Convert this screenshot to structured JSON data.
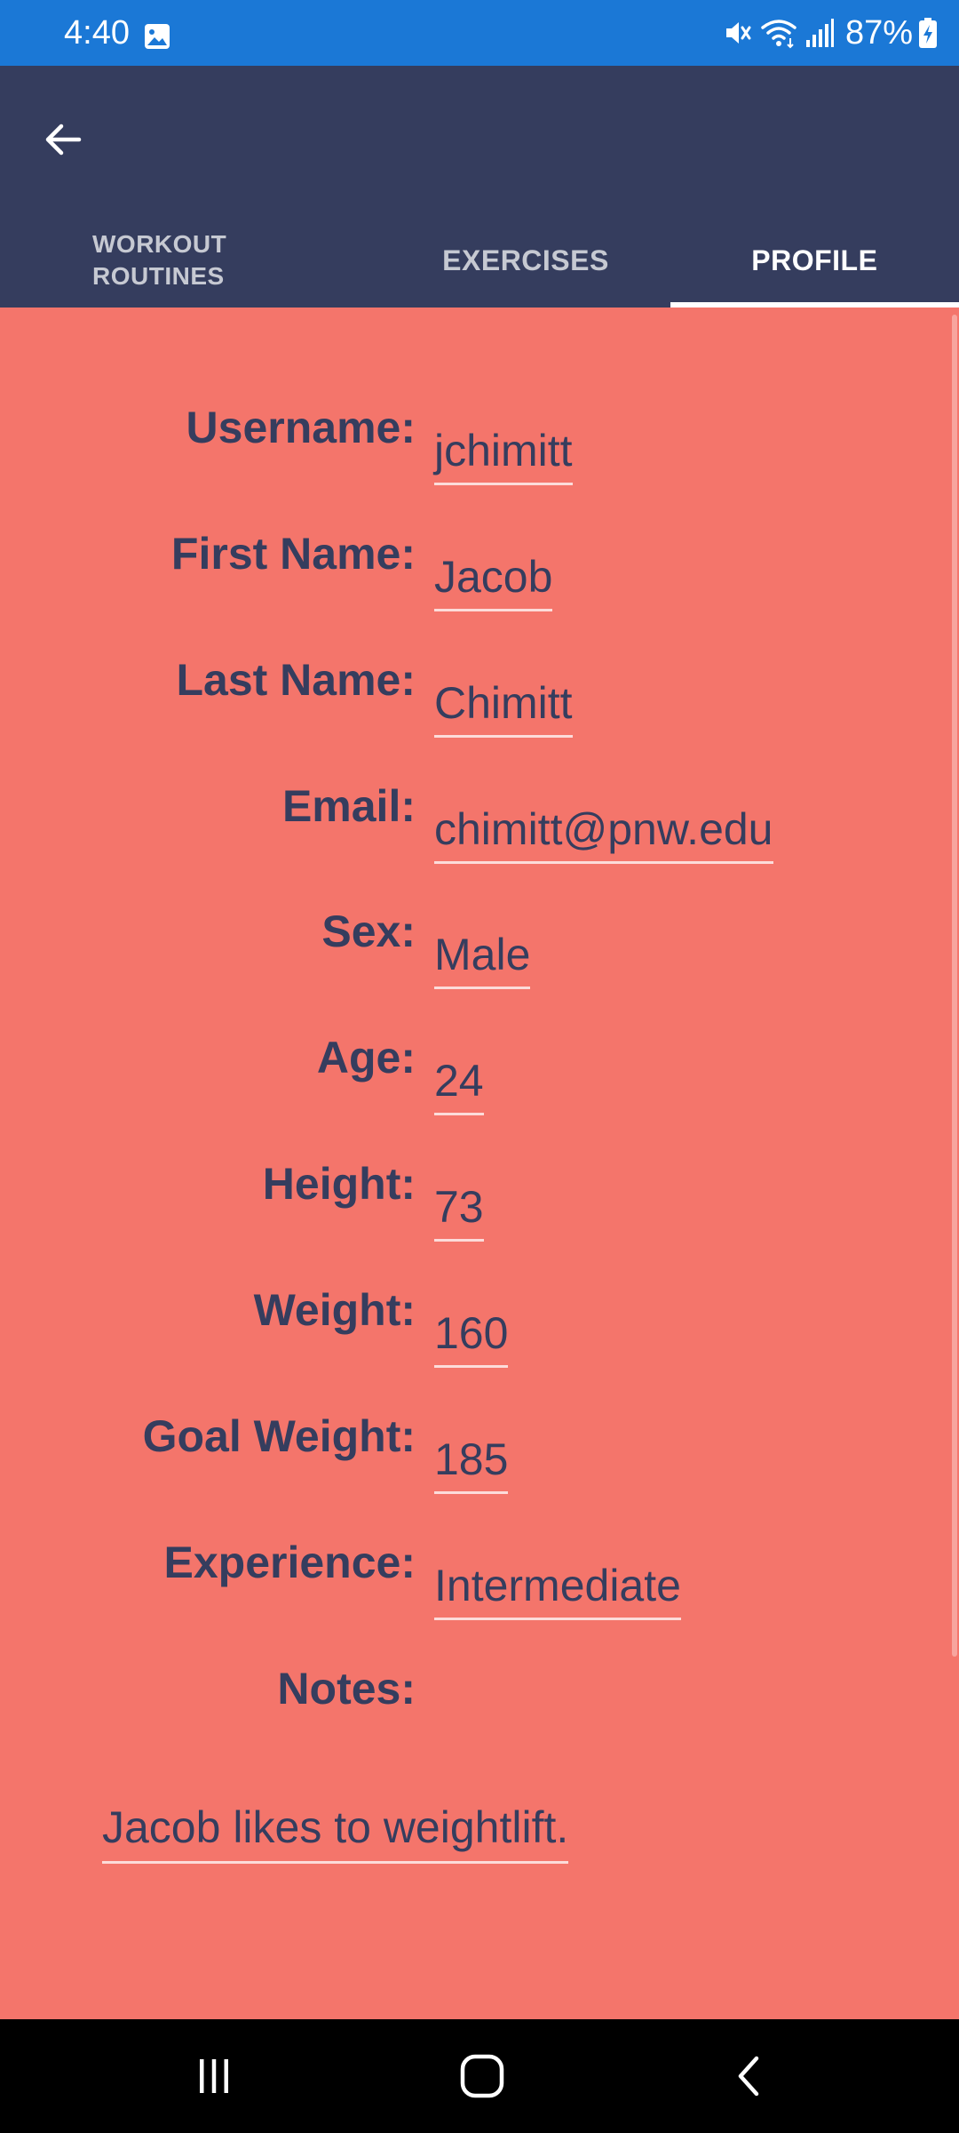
{
  "status_bar": {
    "time": "4:40",
    "battery": "87%",
    "icons": [
      "gallery-icon",
      "mute-icon",
      "wifi-icon",
      "signal-icon",
      "battery-charging-icon"
    ]
  },
  "app_bar": {
    "back_icon": "arrow-left-icon",
    "tabs": [
      {
        "line1": "WORKOUT",
        "line2": "ROUTINES",
        "active": false
      },
      {
        "label": "EXERCISES",
        "active": false
      },
      {
        "label": "PROFILE",
        "active": true
      }
    ]
  },
  "profile": {
    "fields": [
      {
        "label": "Username:",
        "value": "jchimitt"
      },
      {
        "label": "First Name:",
        "value": "Jacob"
      },
      {
        "label": "Last Name:",
        "value": "Chimitt"
      },
      {
        "label": "Email:",
        "value": "chimitt@pnw.edu"
      },
      {
        "label": "Sex:",
        "value": "Male"
      },
      {
        "label": "Age:",
        "value": "24"
      },
      {
        "label": "Height:",
        "value": "73"
      },
      {
        "label": "Weight:",
        "value": "160"
      },
      {
        "label": "Goal Weight:",
        "value": "185"
      },
      {
        "label": "Experience:",
        "value": "Intermediate"
      }
    ],
    "notes_label": "Notes:",
    "notes_value": "Jacob likes to weightlift."
  },
  "nav_bar": {
    "icons": [
      "recent-apps-icon",
      "home-icon",
      "back-icon"
    ]
  },
  "colors": {
    "status_bar": "#1B78D6",
    "app_bar": "#353D5E",
    "content_background": "#F4756B",
    "text": "#353D5E",
    "nav_bar": "#000000"
  }
}
